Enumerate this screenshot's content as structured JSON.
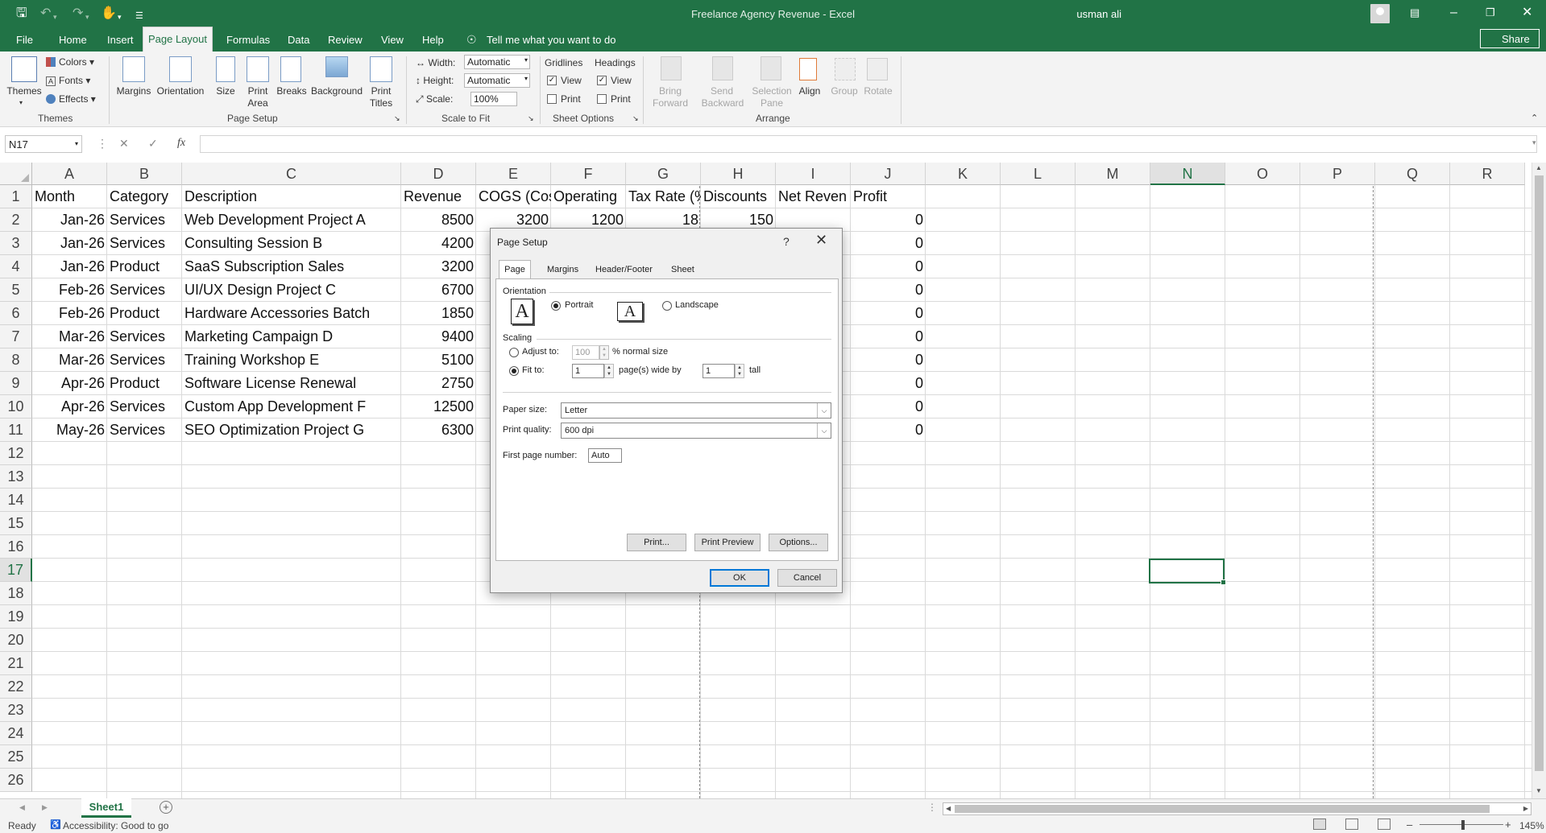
{
  "app": {
    "title": "Freelance Agency Revenue  -  Excel",
    "user": "usman ali",
    "share_label": "Share"
  },
  "menu": {
    "tabs": [
      "File",
      "Home",
      "Insert",
      "Page Layout",
      "Formulas",
      "Data",
      "Review",
      "View",
      "Help"
    ],
    "tell_me": "Tell me what you want to do"
  },
  "ribbon": {
    "themes": {
      "themes_label": "Themes",
      "colors_label": "Colors",
      "fonts_label": "Fonts",
      "effects_label": "Effects",
      "group_label": "Themes"
    },
    "page_setup": {
      "margins": "Margins",
      "orientation": "Orientation",
      "size": "Size",
      "print_area_1": "Print",
      "print_area_2": "Area",
      "breaks": "Breaks",
      "background": "Background",
      "print_titles_1": "Print",
      "print_titles_2": "Titles",
      "group_label": "Page Setup"
    },
    "scale_to_fit": {
      "width_label": "Width:",
      "width_value": "Automatic",
      "height_label": "Height:",
      "height_value": "Automatic",
      "scale_label": "Scale:",
      "scale_value": "100%",
      "group_label": "Scale to Fit"
    },
    "sheet_options": {
      "gridlines": "Gridlines",
      "headings": "Headings",
      "view": "View",
      "print": "Print",
      "group_label": "Sheet Options"
    },
    "arrange": {
      "bring_forward_1": "Bring",
      "bring_forward_2": "Forward",
      "send_backward_1": "Send",
      "send_backward_2": "Backward",
      "selection_pane_1": "Selection",
      "selection_pane_2": "Pane",
      "align": "Align",
      "group": "Group",
      "rotate": "Rotate",
      "group_label": "Arrange"
    }
  },
  "formula_bar": {
    "name_box": "N17",
    "fx": "fx",
    "content": ""
  },
  "sheet": {
    "columns": [
      "A",
      "B",
      "C",
      "D",
      "E",
      "F",
      "G",
      "H",
      "I",
      "J",
      "K",
      "L",
      "M",
      "N",
      "O",
      "P",
      "Q",
      "R"
    ],
    "selected_column": "N",
    "selected_row": "17",
    "rows": [
      "1",
      "2",
      "3",
      "4",
      "5",
      "6",
      "7",
      "8",
      "9",
      "10",
      "11",
      "12",
      "13",
      "14",
      "15",
      "16",
      "17",
      "18",
      "19",
      "20",
      "21",
      "22",
      "23",
      "24",
      "25",
      "26"
    ],
    "headers": [
      "Month",
      "Category",
      "Description",
      "Revenue",
      "COGS (Cos",
      "Operating",
      "Tax Rate (%",
      "Discounts",
      "Net Reven",
      "Profit"
    ],
    "data": [
      [
        "Jan-26",
        "Services",
        "Web Development Project A",
        "8500",
        "3200",
        "1200",
        "18",
        "150",
        "",
        "0"
      ],
      [
        "Jan-26",
        "Services",
        "Consulting Session B",
        "4200",
        "",
        "",
        "",
        "",
        "",
        "0"
      ],
      [
        "Jan-26",
        "Product",
        "SaaS Subscription Sales",
        "3200",
        "",
        "",
        "",
        "",
        "",
        "0"
      ],
      [
        "Feb-26",
        "Services",
        "UI/UX Design Project C",
        "6700",
        "",
        "",
        "",
        "",
        "",
        "0"
      ],
      [
        "Feb-26",
        "Product",
        "Hardware Accessories Batch",
        "1850",
        "",
        "",
        "",
        "",
        "",
        "0"
      ],
      [
        "Mar-26",
        "Services",
        "Marketing Campaign D",
        "9400",
        "",
        "",
        "",
        "",
        "",
        "0"
      ],
      [
        "Mar-26",
        "Services",
        "Training Workshop E",
        "5100",
        "",
        "",
        "",
        "",
        "",
        "0"
      ],
      [
        "Apr-26",
        "Product",
        "Software License Renewal",
        "2750",
        "",
        "",
        "",
        "",
        "",
        "0"
      ],
      [
        "Apr-26",
        "Services",
        "Custom App Development F",
        "12500",
        "",
        "",
        "",
        "",
        "",
        "0"
      ],
      [
        "May-26",
        "Services",
        "SEO Optimization Project G",
        "6300",
        "",
        "",
        "",
        "",
        "",
        "0"
      ]
    ]
  },
  "sheet_tabs": {
    "active": "Sheet1"
  },
  "status": {
    "ready": "Ready",
    "accessibility": "Accessibility: Good to go",
    "zoom": "145%"
  },
  "dialog": {
    "title": "Page Setup",
    "help": "?",
    "tabs": [
      "Page",
      "Margins",
      "Header/Footer",
      "Sheet"
    ],
    "orientation_label": "Orientation",
    "portrait": "Portrait",
    "landscape": "Landscape",
    "scaling_label": "Scaling",
    "adjust_to": "Adjust to:",
    "adjust_value": "100",
    "normal_size": "% normal size",
    "fit_to": "Fit to:",
    "fit_wide": "1",
    "pages_wide_by": "page(s) wide by",
    "fit_tall": "1",
    "tall": "tall",
    "paper_size_label": "Paper size:",
    "paper_size": "Letter",
    "print_quality_label": "Print quality:",
    "print_quality": "600 dpi",
    "first_page_label": "First page number:",
    "first_page": "Auto",
    "print_btn": "Print...",
    "preview_btn": "Print Preview",
    "options_btn": "Options...",
    "ok_btn": "OK",
    "cancel_btn": "Cancel"
  }
}
